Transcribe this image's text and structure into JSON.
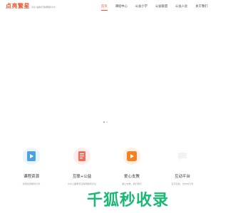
{
  "logo": {
    "mark": "点亮繁星",
    "tagline": "农村儿童教育互联网服务平台"
  },
  "nav": {
    "items": [
      {
        "label": "首页",
        "active": true
      },
      {
        "label": "课程中心",
        "active": false
      },
      {
        "label": "公益小学",
        "active": false
      },
      {
        "label": "公益联盟",
        "active": false
      },
      {
        "label": "公益入驻",
        "active": false
      },
      {
        "label": "关于我们",
        "active": false
      }
    ]
  },
  "carousel": {
    "slide_count": 2,
    "active_index": 0,
    "colors": {
      "active": "#7aa0c8",
      "inactive": "#d6d6d6"
    }
  },
  "features": [
    {
      "title": "课程资源",
      "desc": "优质资源随时分享",
      "icon": "play-card-icon",
      "color": "#4aa3df",
      "bg": "#e9f4fc"
    },
    {
      "title": "互联+公益",
      "desc": "乡村儿童教育互联网服务平台",
      "icon": "document-list-icon",
      "color": "#f26b5b",
      "bg": "#fdecea"
    },
    {
      "title": "爱心支教",
      "desc": "爱心支教，我们同行",
      "icon": "play-square-icon",
      "color": "#f5821f",
      "bg": "#fef0e3"
    },
    {
      "title": "互动平台",
      "desc": "互享互助，合作共分享",
      "icon": "chat-icon",
      "color": "#e8e8e8",
      "bg": "#ffffff"
    }
  ],
  "watermark": {
    "text": "千狐秒收录",
    "color": "#19b874"
  },
  "colors": {
    "accent": "#e8552b"
  }
}
